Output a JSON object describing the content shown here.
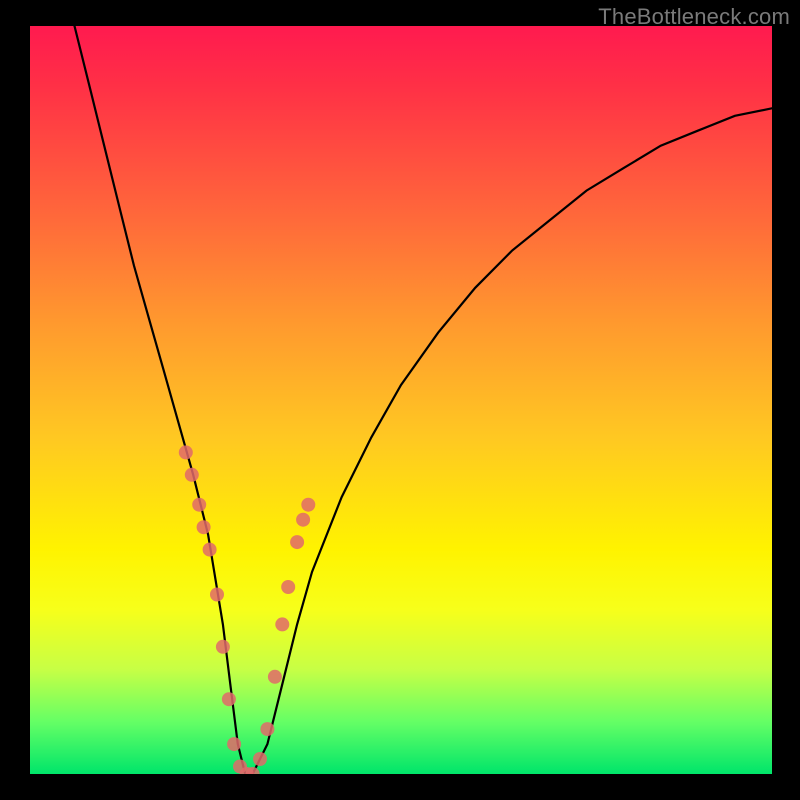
{
  "watermark": {
    "text": "TheBottleneck.com"
  },
  "chart_data": {
    "type": "line",
    "title": "",
    "xlabel": "",
    "ylabel": "",
    "xlim": [
      0,
      100
    ],
    "ylim": [
      0,
      100
    ],
    "series": [
      {
        "name": "bottleneck-curve",
        "x": [
          6,
          8,
          10,
          12,
          14,
          16,
          18,
          20,
          22,
          24,
          26,
          27,
          28,
          29,
          30,
          32,
          34,
          36,
          38,
          42,
          46,
          50,
          55,
          60,
          65,
          70,
          75,
          80,
          85,
          90,
          95,
          100
        ],
        "y": [
          100,
          92,
          84,
          76,
          68,
          61,
          54,
          47,
          40,
          32,
          20,
          12,
          4,
          0,
          0,
          4,
          12,
          20,
          27,
          37,
          45,
          52,
          59,
          65,
          70,
          74,
          78,
          81,
          84,
          86,
          88,
          89
        ]
      }
    ],
    "markers": {
      "name": "highlight-points",
      "color": "#e06a6a",
      "x": [
        21.0,
        21.8,
        22.8,
        23.4,
        24.2,
        25.2,
        26.0,
        26.8,
        27.5,
        28.3,
        29.2,
        30.0,
        31.0,
        32.0,
        33.0,
        34.0,
        34.8,
        36.0,
        36.8,
        37.5
      ],
      "y": [
        43,
        40,
        36,
        33,
        30,
        24,
        17,
        10,
        4,
        1,
        0,
        0,
        2,
        6,
        13,
        20,
        25,
        31,
        34,
        36
      ]
    },
    "gradient_stops": [
      {
        "pos": 0,
        "color": "#ff1a4f"
      },
      {
        "pos": 26,
        "color": "#ff6a3a"
      },
      {
        "pos": 55,
        "color": "#ffc822"
      },
      {
        "pos": 78,
        "color": "#f7ff1a"
      },
      {
        "pos": 93,
        "color": "#65ff65"
      },
      {
        "pos": 100,
        "color": "#00e56a"
      }
    ]
  }
}
